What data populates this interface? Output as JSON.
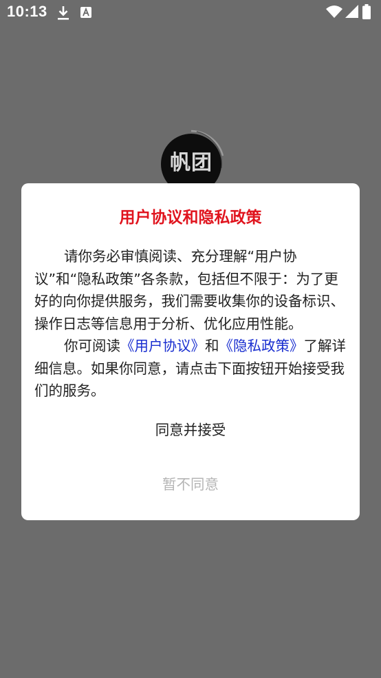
{
  "status_bar": {
    "time": "10:13",
    "icons": [
      "download-icon",
      "a-icon",
      "wifi-icon",
      "signal-icon",
      "battery-icon"
    ]
  },
  "logo": {
    "text": "帆团"
  },
  "dialog": {
    "title": "用户协议和隐私政策",
    "paragraph1": "请你务必审慎阅读、充分理解“用户协议”和“隐私政策”各条款，包括但不限于：为了更好的向你提供服务，我们需要收集你的设备标识、操作日志等信息用于分析、优化应用性能。",
    "paragraph2_prefix": "你可阅读",
    "user_agreement_link": "《用户协议》",
    "paragraph2_and": "和",
    "privacy_policy_link": "《隐私政策》",
    "paragraph2_suffix": "了解详细信息。如果你同意，请点击下面按钮开始接受我们的服务。",
    "agree_label": "同意并接受",
    "disagree_label": "暂不同意"
  },
  "colors": {
    "backdrop": "#6c6c6c",
    "title": "#e0141e",
    "link": "#1a2fd0",
    "disagree": "#b5b5b5"
  }
}
